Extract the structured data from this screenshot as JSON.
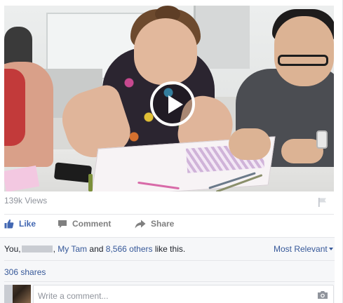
{
  "post": {
    "video": {
      "play_icon": "play-icon"
    },
    "views_text": "139k Views",
    "flag_icon": "flag-icon"
  },
  "actions": {
    "like_label": "Like",
    "comment_label": "Comment",
    "share_label": "Share",
    "like_icon": "thumbs-up-icon",
    "comment_icon": "speech-bubble-icon",
    "share_icon": "share-arrow-icon"
  },
  "likes": {
    "prefix": "You,",
    "friend_name": "My Tam",
    "connector": "and",
    "others_link": "8,566 others",
    "suffix": "like this.",
    "sort_label": "Most Relevant"
  },
  "shares_text": "306 shares",
  "comment_input": {
    "placeholder": "Write a comment...",
    "camera_icon": "camera-icon"
  },
  "colors": {
    "link_blue": "#365899",
    "like_blue": "#4267b2",
    "muted_gray": "#90949c",
    "panel_bg": "#f6f7f9"
  }
}
